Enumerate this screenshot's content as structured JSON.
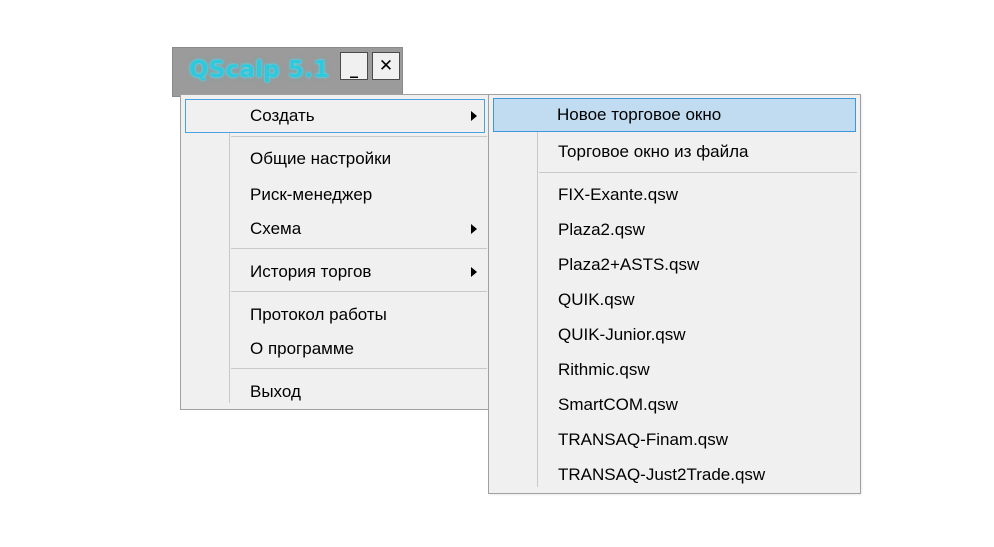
{
  "window": {
    "title": "QScalp 5.1",
    "minimize_label": "_",
    "close_label": "✕"
  },
  "main_menu": {
    "items": [
      {
        "label": "Создать",
        "has_submenu": true,
        "state": "open"
      },
      {
        "label": "Общие настройки"
      },
      {
        "label": "Риск-менеджер"
      },
      {
        "label": "Схема",
        "has_submenu": true
      },
      {
        "label": "История торгов",
        "has_submenu": true
      },
      {
        "label": "Протокол работы"
      },
      {
        "label": "О программе"
      },
      {
        "label": "Выход"
      }
    ]
  },
  "sub_menu": {
    "items": [
      {
        "label": "Новое торговое окно",
        "state": "selected"
      },
      {
        "label": "Торговое окно из файла"
      },
      {
        "label": "FIX-Exante.qsw"
      },
      {
        "label": "Plaza2.qsw"
      },
      {
        "label": "Plaza2+ASTS.qsw"
      },
      {
        "label": "QUIK.qsw"
      },
      {
        "label": "QUIK-Junior.qsw"
      },
      {
        "label": "Rithmic.qsw"
      },
      {
        "label": "SmartCOM.qsw"
      },
      {
        "label": "TRANSAQ-Finam.qsw"
      },
      {
        "label": "TRANSAQ-Just2Trade.qsw"
      }
    ]
  },
  "colors": {
    "title_accent": "#2cc9df",
    "selection_bg": "#c1dcf0",
    "selection_border": "#3e97d8"
  }
}
